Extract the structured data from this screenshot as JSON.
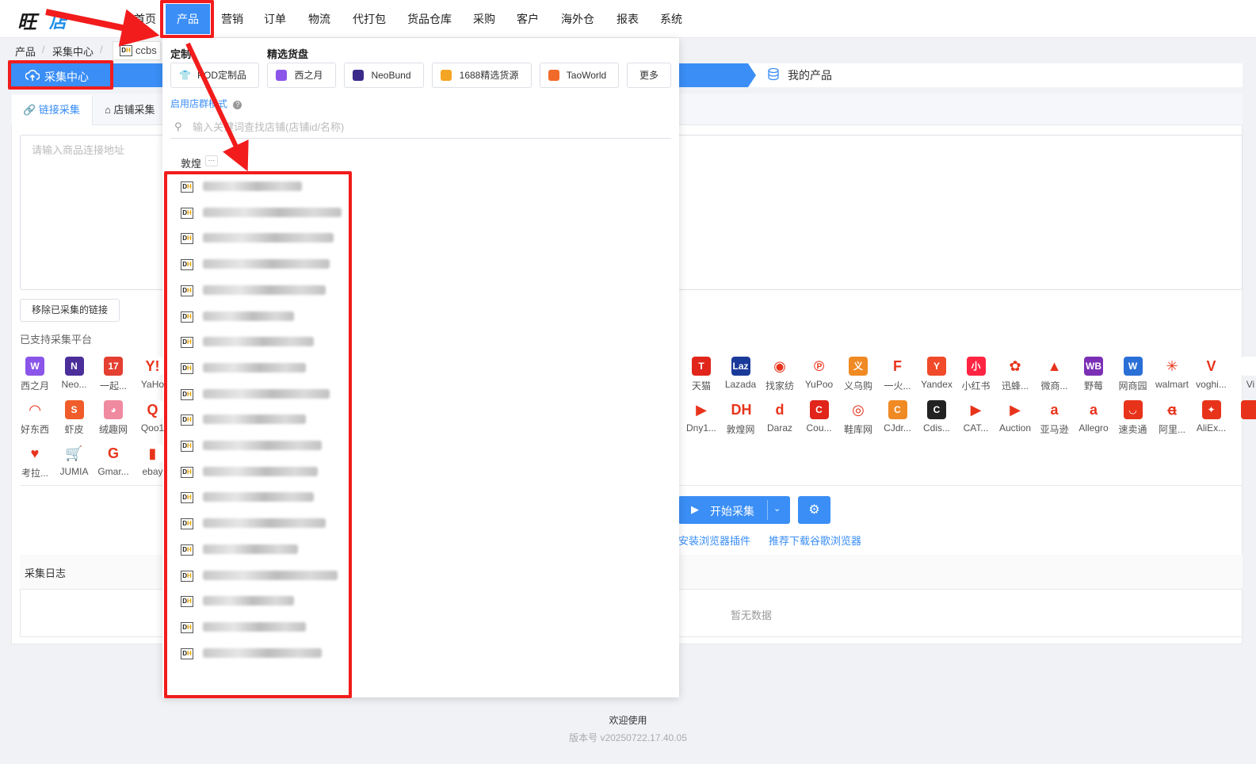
{
  "app": {
    "logo_text_a": "旺",
    "logo_text_b": "店"
  },
  "nav": [
    "首页",
    "产品",
    "营销",
    "订单",
    "物流",
    "代打包",
    "货品仓库",
    "采购",
    "客户",
    "海外仓",
    "报表",
    "系统"
  ],
  "breadcrumb": {
    "items": [
      "产品",
      "采集中心"
    ],
    "open_tab": "ccbs"
  },
  "steps": {
    "current": "采集中心",
    "next": "我的产品"
  },
  "tabs": {
    "link": "链接采集",
    "store": "店铺采集"
  },
  "textarea_placeholder": "请输入商品连接地址",
  "remove_button": "移除已采集的链接",
  "platforms_title": "已支持采集平台",
  "platforms_left": [
    {
      "name": "西之月",
      "color": "#8a55e8",
      "glyph": "W"
    },
    {
      "name": "Neo...",
      "color": "#4b2e9a",
      "glyph": "N"
    },
    {
      "name": "一起...",
      "color": "#e43f31",
      "glyph": "17"
    },
    {
      "name": "YaHo",
      "color": "#ffffff",
      "glyph": "Y!"
    },
    {
      "name": "好东西",
      "color": "#ffffff",
      "glyph": "◠"
    },
    {
      "name": "虾皮",
      "color": "#f05d2a",
      "glyph": "S"
    },
    {
      "name": "绒趣网",
      "color": "#f08aa0",
      "glyph": "◕"
    },
    {
      "name": "Qoo1",
      "color": "#ffffff",
      "glyph": "Q"
    },
    {
      "name": "考拉...",
      "color": "#ffffff",
      "glyph": "♥"
    },
    {
      "name": "JUMIA",
      "color": "#ffffff",
      "glyph": "🛒"
    },
    {
      "name": "Gmar...",
      "color": "#ffffff",
      "glyph": "G"
    },
    {
      "name": "ebay",
      "color": "#ffffff",
      "glyph": "▮"
    }
  ],
  "platforms_right_row1": [
    {
      "name": "天猫",
      "color": "#e1251b",
      "glyph": "T"
    },
    {
      "name": "Lazada",
      "color": "#1a3a9a",
      "glyph": "Laz"
    },
    {
      "name": "找家纺",
      "color": "#ffffff",
      "glyph": "◉"
    },
    {
      "name": "YuPoo",
      "color": "#ffffff",
      "glyph": "℗"
    },
    {
      "name": "义乌购",
      "color": "#f08a24",
      "glyph": "义"
    },
    {
      "name": "一火...",
      "color": "#ffffff",
      "glyph": "F"
    },
    {
      "name": "Yandex",
      "color": "#f04a2a",
      "glyph": "Y"
    },
    {
      "name": "小红书",
      "color": "#ff2442",
      "glyph": "小"
    },
    {
      "name": "迅蜂...",
      "color": "#ffffff",
      "glyph": "✿"
    },
    {
      "name": "微商...",
      "color": "#ffffff",
      "glyph": "▲"
    },
    {
      "name": "野莓",
      "color": "#7b2fb5",
      "glyph": "WB"
    },
    {
      "name": "网商园",
      "color": "#2a6fd6",
      "glyph": "W"
    },
    {
      "name": "walmart",
      "color": "#ffffff",
      "glyph": "✳"
    },
    {
      "name": "voghi...",
      "color": "#ffffff",
      "glyph": "V"
    },
    {
      "name": "Vi",
      "color": "#ffffff",
      "glyph": ""
    }
  ],
  "platforms_right_row2": [
    {
      "name": "Dny1...",
      "color": "#ffffff",
      "glyph": "▶"
    },
    {
      "name": "敦煌网",
      "color": "#ffffff",
      "glyph": "DH"
    },
    {
      "name": "Daraz",
      "color": "#ffffff",
      "glyph": "d"
    },
    {
      "name": "Cou...",
      "color": "#e1251b",
      "glyph": "C"
    },
    {
      "name": "鞋库网",
      "color": "#ffffff",
      "glyph": "◎"
    },
    {
      "name": "CJdr...",
      "color": "#f08a24",
      "glyph": "C"
    },
    {
      "name": "Cdis...",
      "color": "#222222",
      "glyph": "C"
    },
    {
      "name": "CAT...",
      "color": "#ffffff",
      "glyph": "▶"
    },
    {
      "name": "Auction",
      "color": "#ffffff",
      "glyph": "▶"
    },
    {
      "name": "亚马逊",
      "color": "#ffffff",
      "glyph": "a"
    },
    {
      "name": "Allegro",
      "color": "#ffffff",
      "glyph": "a"
    },
    {
      "name": "速卖通",
      "color": "#e8331b",
      "glyph": "◡"
    },
    {
      "name": "阿里...",
      "color": "#ffffff",
      "glyph": "ꬰ"
    },
    {
      "name": "AliEx...",
      "color": "#e8331b",
      "glyph": "✦"
    },
    {
      "name": "",
      "color": "#e8331b",
      "glyph": ""
    }
  ],
  "start_button": "开始采集",
  "links": {
    "install": "安装浏览器插件",
    "download": "推荐下载谷歌浏览器"
  },
  "log": {
    "title": "采集日志",
    "empty": "暂无数据"
  },
  "footer": {
    "welcome": "欢迎使用",
    "version": "版本号 v20250722.17.40.05"
  },
  "dropdown": {
    "custom_title": "定制",
    "pod_button": "POD定制品",
    "source_title": "精选货盘",
    "source_buttons": [
      "西之月",
      "NeoBund",
      "1688精选货源",
      "TaoWorld",
      "更多"
    ],
    "store_mode_link": "启用店群模式",
    "search_placeholder": "输入关键词查找店铺(店铺id/名称)",
    "group_title": "敦煌",
    "store_count": 19
  }
}
